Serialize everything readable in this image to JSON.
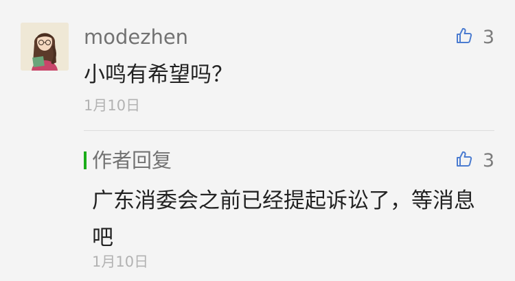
{
  "comment": {
    "nickname": "modezhen",
    "content": "小鸣有希望吗？",
    "date": "1月10日",
    "like_count": "3",
    "like_icon": "thumbs-up-icon",
    "avatar_icon": "avatar-illustration"
  },
  "reply": {
    "label": "作者回复",
    "content": "广东消委会之前已经提起诉讼了，等消息吧",
    "date": "1月10日",
    "like_count": "3",
    "like_icon": "thumbs-up-icon",
    "accent_color": "#1aad19"
  },
  "colors": {
    "background": "#f4f4f4",
    "secondary_text": "#727272",
    "primary_text": "#222222",
    "date_text": "#b2b2b2",
    "divider": "#dcdcdc",
    "icon": "#4a7bd0"
  }
}
